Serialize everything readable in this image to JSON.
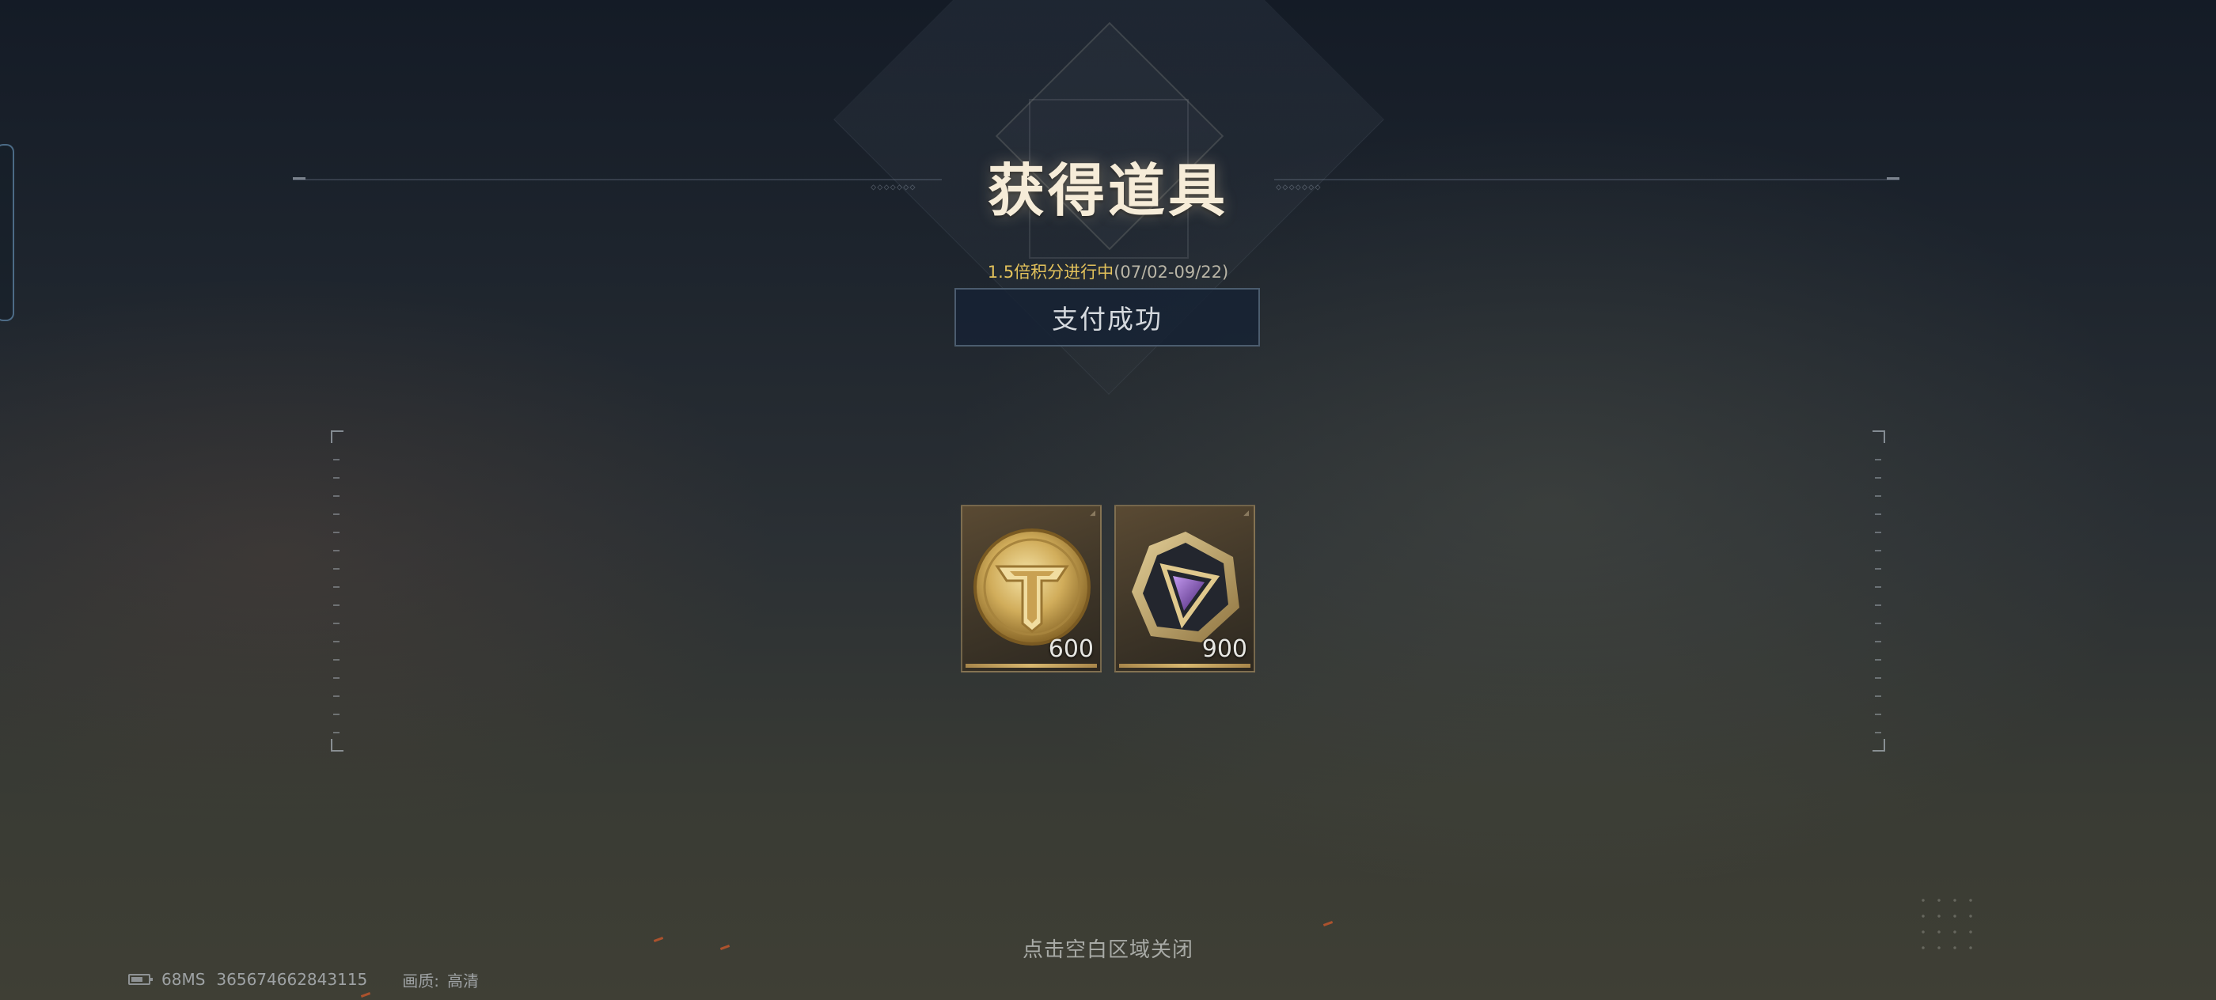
{
  "dialog": {
    "title": "获得道具",
    "event_text": "1.5倍积分进行中",
    "event_dates": "(07/02-09/22)",
    "payment_status": "支付成功",
    "close_hint": "点击空白区域关闭"
  },
  "items": [
    {
      "icon": "gold-coin-icon",
      "quantity": "600"
    },
    {
      "icon": "purple-gem-icon",
      "quantity": "900"
    }
  ],
  "status_bar": {
    "ping": "68MS",
    "player_id": "365674662843115",
    "quality_label": "画质:",
    "quality_value": "高清"
  },
  "colors": {
    "title": "#f6ecd8",
    "event_accent": "#e3c25b",
    "pay_box_bg": "#16223a",
    "item_bar_gold": "#d8b76e"
  }
}
